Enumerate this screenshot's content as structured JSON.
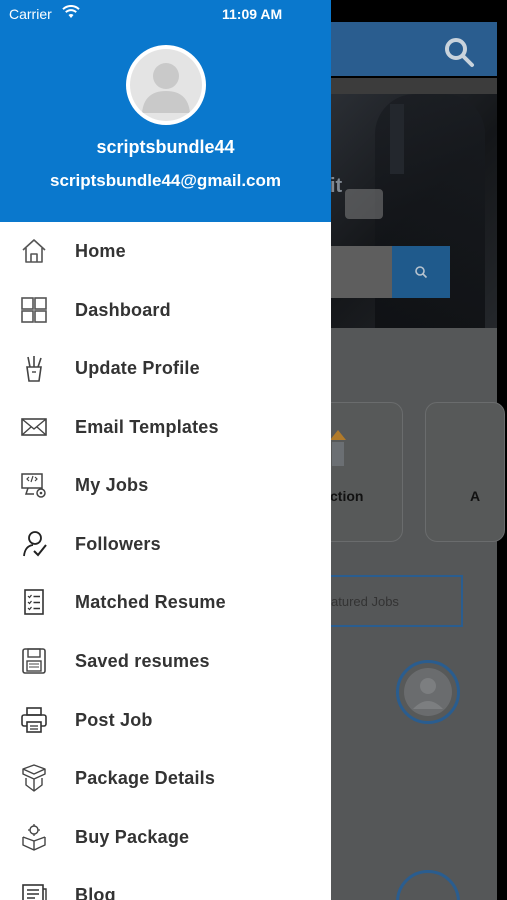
{
  "status_bar": {
    "carrier": "Carrier",
    "time": "11:09 AM"
  },
  "profile": {
    "username": "scriptsbundle44",
    "email": "scriptsbundle44@gmail.com"
  },
  "menu": {
    "items": [
      {
        "label": "Home",
        "icon": "home-icon"
      },
      {
        "label": "Dashboard",
        "icon": "dashboard-grid-icon"
      },
      {
        "label": "Update Profile",
        "icon": "pencil-cup-icon"
      },
      {
        "label": "Email Templates",
        "icon": "envelope-icon"
      },
      {
        "label": "My Jobs",
        "icon": "monitor-gear-icon"
      },
      {
        "label": "Followers",
        "icon": "user-check-icon"
      },
      {
        "label": "Matched Resume",
        "icon": "checklist-icon"
      },
      {
        "label": "Saved resumes",
        "icon": "floppy-disk-icon"
      },
      {
        "label": "Post Job",
        "icon": "printer-icon"
      },
      {
        "label": "Package Details",
        "icon": "open-box-icon"
      },
      {
        "label": "Buy Package",
        "icon": "box-gear-icon"
      },
      {
        "label": "Blog",
        "icon": "blog-document-icon"
      }
    ]
  },
  "background_app": {
    "hero_text": "it",
    "card_label_1": "ction",
    "card_label_2": "A",
    "tab_label": "atured Jobs"
  },
  "colors": {
    "primary": "#0a78cd",
    "text": "#333333",
    "overlay_header": "#2a5d8f"
  }
}
